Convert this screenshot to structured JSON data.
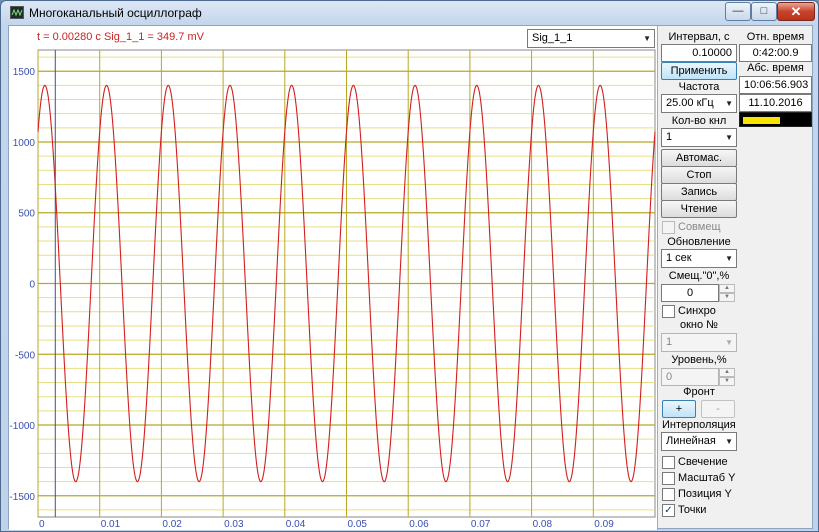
{
  "window": {
    "title": "Многоканальный осциллограф",
    "buttons": {
      "minimize": "—",
      "maximize": "□",
      "close": "✕"
    }
  },
  "plot": {
    "readout": "t = 0.00280 c  Sig_1_1 = 349.7 mV",
    "channel_select": "Sig_1_1",
    "background": "#ffffff",
    "grid_major_color": "#b8a825",
    "grid_minor_color": "#e8df86",
    "trace_color": "#d21f1f"
  },
  "chart_data": {
    "type": "line",
    "series": [
      {
        "name": "Sig_1_1",
        "amplitude": 1400,
        "frequency_hz": 100,
        "phase_deg": 50
      }
    ],
    "x_range": [
      0,
      0.1
    ],
    "y_range": [
      -1650,
      1650
    ],
    "x_ticks": [
      "0",
      "0.01",
      "0.02",
      "0.03",
      "0.04",
      "0.05",
      "0.06",
      "0.07",
      "0.08",
      "0.09"
    ],
    "x_tick_values": [
      0,
      0.01,
      0.02,
      0.03,
      0.04,
      0.05,
      0.06,
      0.07,
      0.08,
      0.09
    ],
    "y_ticks": [
      "1500",
      "1000",
      "500",
      "0",
      "-500",
      "-1000",
      "-1500"
    ],
    "y_tick_values": [
      1500,
      1000,
      500,
      0,
      -500,
      -1000,
      -1500
    ],
    "cursor_x": 0.0028,
    "grid": true
  },
  "panel": {
    "interval_label": "Интервал, с",
    "interval_value": "0.10000",
    "apply_button": "Применить",
    "freq_label": "Частота",
    "freq_value": "25.00 кГц",
    "channels_label": "Кол-во кнл",
    "channels_value": "1",
    "auto_scale_button": "Автомас.",
    "stop_button": "Стоп",
    "record_button": "Запись",
    "read_button": "Чтение",
    "combine_label": "Совмещ",
    "update_label": "Обновление",
    "update_value": "1 сек",
    "offset_label": "Смещ.\"0\",%",
    "offset_value": "0",
    "sync_label": "Синхро",
    "window_no_label": "окно №",
    "window_no_value": "1",
    "level_label": "Уровень,%",
    "level_value": "0",
    "front_label": "Фронт",
    "front_plus": "+",
    "front_minus": "-",
    "interp_label": "Интерполяция",
    "interp_value": "Линейная",
    "glow_label": "Свечение",
    "scale_y_label": "Масштаб Y",
    "pos_y_label": "Позиция Y",
    "points_label": "Точки",
    "points_checked": "✓",
    "rel_time_label": "Отн. время",
    "rel_time_value": "0:42:00.9",
    "abs_time_label": "Абс. время",
    "abs_time_value": "10:06:56.903",
    "date_value": "11.10.2016",
    "indicator_color": "#f6e300"
  }
}
